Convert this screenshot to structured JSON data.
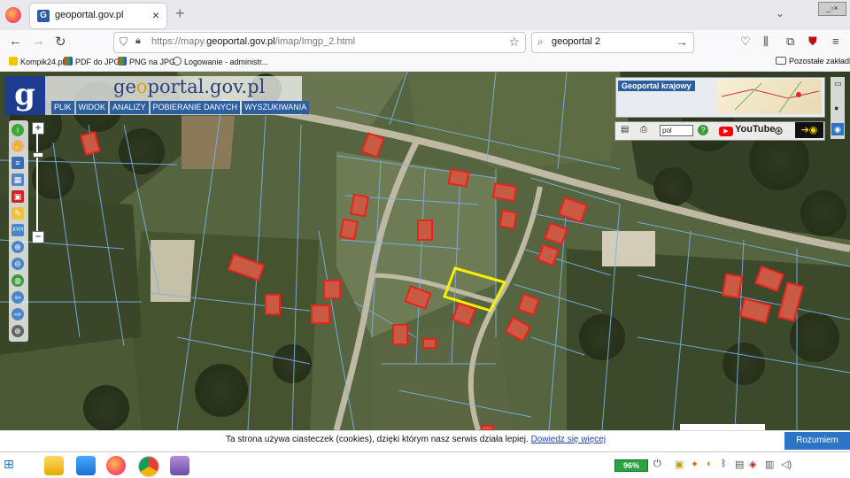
{
  "browser": {
    "tab_title": "geoportal.gov.pl",
    "tab_favicon": "G",
    "new_tab": "+",
    "url_prefix": "https://mapy.",
    "url_domain": "geoportal.gov.pl",
    "url_suffix": "/imap/Imgp_2.html",
    "search_query": "geoportal 2",
    "bookmarks": [
      "Kompik24.pl",
      "PDF do JPG",
      "PNG na JPG",
      "Logowanie - administr...",
      "Pozostałe zakładki"
    ]
  },
  "geoportal": {
    "logo": "g",
    "title_prefix": "ge",
    "title_o": "o",
    "title_rest": "portal.gov.pl",
    "menu": [
      "PLIK",
      "WIDOK",
      "ANALIZY",
      "POBIERANIE DANYCH",
      "WYSZUKIWANIA"
    ],
    "overview_label": "Geoportal krajowy",
    "language": "pol",
    "youtube": "YouTube",
    "zoom_plus": "+",
    "zoom_minus": "−",
    "zoom_level": 0.2
  },
  "cookie": {
    "text": "Ta strona używa ciasteczek (cookies), dzięki którym nasz serwis działa lepiej.",
    "link": "Dowiedz się więcej",
    "button": "Rozumiem"
  },
  "taskbar": {
    "battery": "96%"
  },
  "colors": {
    "parcel_lines": "#7fb0e8",
    "buildings": "#e8231c",
    "selected_parcel": "#f5f000",
    "gp_blue": "#2d5fa0"
  }
}
